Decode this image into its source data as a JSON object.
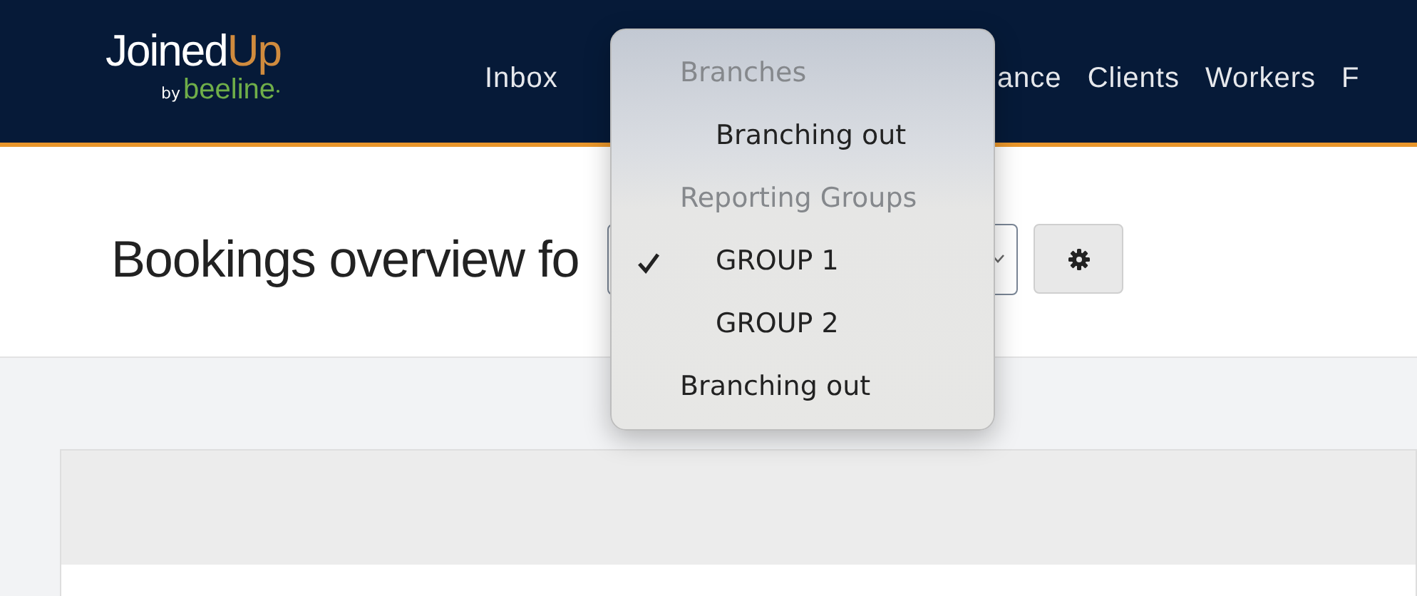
{
  "header": {
    "logo": {
      "wordmark": "Joined",
      "wordmark_accent": "Up",
      "tagline_by": "by",
      "tagline_brand": "beeline"
    },
    "nav": [
      {
        "label": "Inbox",
        "kind": "full"
      },
      {
        "label": "ance",
        "kind": "covered"
      },
      {
        "label": "Clients",
        "kind": "full"
      },
      {
        "label": "Workers",
        "kind": "full"
      },
      {
        "label": "F",
        "kind": "full"
      }
    ]
  },
  "page": {
    "title": "Bookings overview fo"
  },
  "menu": {
    "items": [
      {
        "kind": "group",
        "label": "Branches",
        "children": [
          {
            "label": "Branching out",
            "selected": false
          }
        ]
      },
      {
        "kind": "group",
        "label": "Reporting Groups",
        "children": [
          {
            "label": "GROUP 1",
            "selected": true
          },
          {
            "label": "GROUP 2",
            "selected": false
          }
        ]
      },
      {
        "kind": "option",
        "label": "Branching out",
        "selected": false
      }
    ]
  }
}
